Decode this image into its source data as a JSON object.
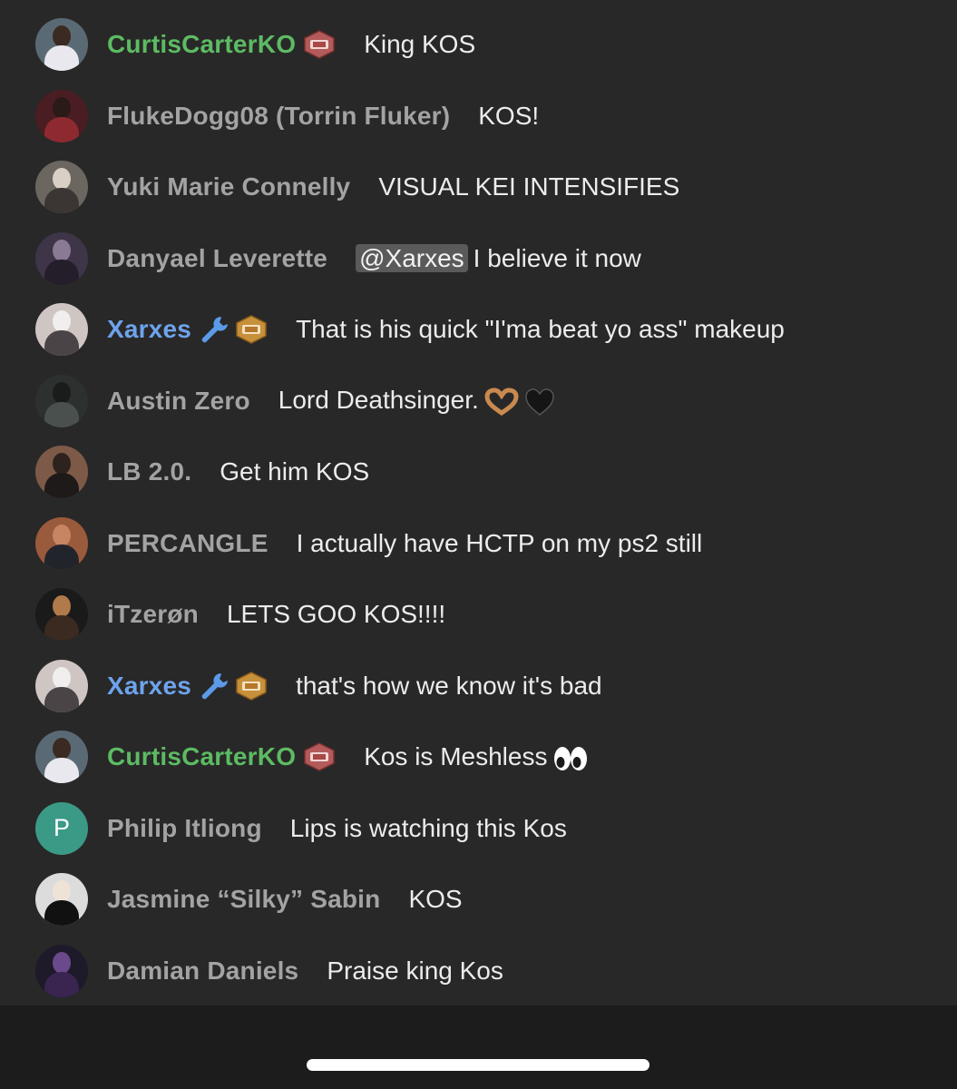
{
  "chat": {
    "messages": [
      {
        "user": "CurtisCarterKO",
        "name_color": "green",
        "badges": [
          "league-badge-red"
        ],
        "text": "King KOS"
      },
      {
        "user": "FlukeDogg08 (Torrin Fluker)",
        "name_color": "gray",
        "badges": [],
        "text": "KOS!"
      },
      {
        "user": "Yuki Marie Connelly",
        "name_color": "gray",
        "badges": [],
        "text": "VISUAL KEI INTENSIFIES"
      },
      {
        "user": "Danyael Leverette",
        "name_color": "gray",
        "badges": [],
        "mention": "@Xarxes",
        "text": "I believe it now"
      },
      {
        "user": "Xarxes",
        "name_color": "blue",
        "badges": [
          "wrench-icon",
          "league-badge-gold"
        ],
        "text": "That is his quick \"I'ma beat yo ass\" makeup"
      },
      {
        "user": "Austin Zero",
        "name_color": "gray",
        "badges": [],
        "text": "Lord Deathsinger.",
        "emojis": [
          "heart-hands-icon",
          "black-heart-icon"
        ]
      },
      {
        "user": "LB 2.0.",
        "name_color": "gray",
        "badges": [],
        "text": "Get him KOS"
      },
      {
        "user": "PERCANGLE",
        "name_color": "gray",
        "badges": [],
        "text": "I actually have HCTP on my ps2 still"
      },
      {
        "user": "iTzerøn",
        "name_color": "gray",
        "badges": [],
        "text": "LETS GOO KOS!!!!"
      },
      {
        "user": "Xarxes",
        "name_color": "blue",
        "badges": [
          "wrench-icon",
          "league-badge-gold"
        ],
        "text": "that's how we know it's bad"
      },
      {
        "user": "CurtisCarterKO",
        "name_color": "green",
        "badges": [
          "league-badge-red"
        ],
        "text": "Kos is Meshless",
        "emojis": [
          "eyes-icon"
        ]
      },
      {
        "user": "Philip Itliong",
        "name_color": "gray",
        "badges": [],
        "avatar_letter": "P",
        "text": "Lips is watching this Kos"
      },
      {
        "user": "Jasmine “Silky” Sabin",
        "name_color": "gray",
        "badges": [],
        "text": "KOS"
      },
      {
        "user": "Damian Daniels",
        "name_color": "gray",
        "badges": [],
        "text": "Praise king Kos"
      }
    ]
  },
  "colors": {
    "background": "#282828",
    "footer": "#1c1c1c",
    "username_gray": "#a3a3a3",
    "username_green": "#5dbb63",
    "username_blue": "#6ea3ec",
    "message_text": "#ececec",
    "mention_bg": "#5a5a5a",
    "letter_avatar_bg": "#3a9a86"
  }
}
